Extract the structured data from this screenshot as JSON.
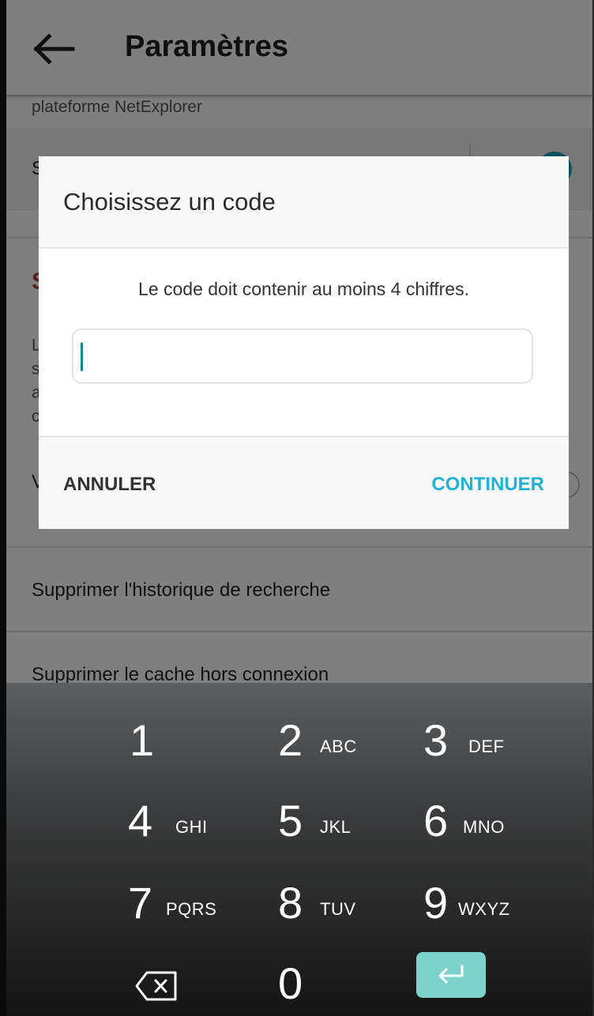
{
  "appbar": {
    "title": "Paramètres"
  },
  "settings": {
    "partial_top": "plateforme NetExplorer",
    "row_clipped_s": "S",
    "section_header_initial": "S",
    "desc_initials": [
      "L",
      "s",
      "a",
      "c"
    ],
    "row_clipped_v": "V",
    "clear_search": "Supprimer l'historique de recherche",
    "clear_cache": "Supprimer le cache hors connexion"
  },
  "dialog": {
    "title": "Choisissez un code",
    "message": "Le code doit contenir au moins 4 chiffres.",
    "input_value": "",
    "cancel_label": "ANNULER",
    "continue_label": "CONTINUER"
  },
  "keypad": {
    "keys": [
      {
        "digit": "1",
        "letters": ""
      },
      {
        "digit": "2",
        "letters": "ABC"
      },
      {
        "digit": "3",
        "letters": "DEF"
      },
      {
        "digit": "4",
        "letters": "GHI"
      },
      {
        "digit": "5",
        "letters": "JKL"
      },
      {
        "digit": "6",
        "letters": "MNO"
      },
      {
        "digit": "7",
        "letters": "PQRS"
      },
      {
        "digit": "8",
        "letters": "TUV"
      },
      {
        "digit": "9",
        "letters": "WXYZ"
      },
      {
        "digit": "0",
        "letters": ""
      }
    ],
    "backspace_icon": "backspace-icon",
    "enter_icon": "enter-icon"
  },
  "colors": {
    "accent": "#22b1d3",
    "caret": "#0e8a8e",
    "toggle": "#1aa3b8",
    "enter_key": "#7cd3cd",
    "section_red": "#b53d2b"
  }
}
